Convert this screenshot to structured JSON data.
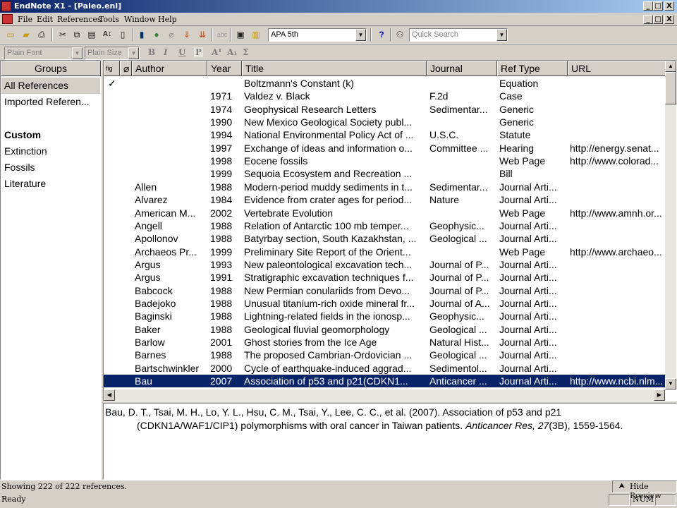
{
  "window": {
    "title": "EndNote X1 - [Paleo.enl]",
    "min": "_",
    "max": "□",
    "close": "X",
    "doc_min": "_",
    "doc_max": "□",
    "doc_close": "X"
  },
  "menu": [
    "File",
    "Edit",
    "References",
    "Tools",
    "Window",
    "Help"
  ],
  "toolbar": {
    "style": "APA 5th",
    "quick_search_placeholder": "Quick Search",
    "help_label": "?",
    "font": "Plain Font",
    "size": "Plain Size",
    "format_buttons": [
      "B",
      "I",
      "U",
      "P",
      "A¹",
      "A₁",
      "Σ"
    ]
  },
  "groups": {
    "header": "Groups",
    "items": [
      {
        "label": "All References"
      },
      {
        "label": "Imported Referen..."
      },
      {
        "label": "Custom"
      },
      {
        "label": "Extinction"
      },
      {
        "label": "Fossils"
      },
      {
        "label": "Literature"
      }
    ]
  },
  "columns": [
    "Author",
    "Year",
    "Title",
    "Journal",
    "Ref Type",
    "URL"
  ],
  "references": [
    {
      "mark": "✓",
      "author": "",
      "year": "",
      "title": "Boltzmann's Constant (k)",
      "journal": "",
      "type": "Equation",
      "url": ""
    },
    {
      "mark": "",
      "author": "",
      "year": "1971",
      "title": "Valdez v. Black",
      "journal": "F.2d",
      "type": "Case",
      "url": ""
    },
    {
      "mark": "",
      "author": "",
      "year": "1974",
      "title": "Geophysical Research Letters",
      "journal": "Sedimentar...",
      "type": "Generic",
      "url": ""
    },
    {
      "mark": "",
      "author": "",
      "year": "1990",
      "title": "New Mexico Geological Society publ...",
      "journal": "",
      "type": "Generic",
      "url": ""
    },
    {
      "mark": "",
      "author": "",
      "year": "1994",
      "title": "National Environmental Policy Act of ...",
      "journal": "U.S.C.",
      "type": "Statute",
      "url": ""
    },
    {
      "mark": "",
      "author": "",
      "year": "1997",
      "title": "Exchange of ideas and information o...",
      "journal": "Committee ...",
      "type": "Hearing",
      "url": "http://energy.senat..."
    },
    {
      "mark": "",
      "author": "",
      "year": "1998",
      "title": "Eocene fossils",
      "journal": "",
      "type": "Web Page",
      "url": "http://www.colorad..."
    },
    {
      "mark": "",
      "author": "",
      "year": "1999",
      "title": "Sequoia Ecosystem and Recreation ...",
      "journal": "",
      "type": "Bill",
      "url": ""
    },
    {
      "mark": "",
      "author": "Allen",
      "year": "1988",
      "title": "Modern-period muddy sediments in t...",
      "journal": "Sedimentar...",
      "type": "Journal Arti...",
      "url": ""
    },
    {
      "mark": "",
      "author": "Alvarez",
      "year": "1984",
      "title": "Evidence from crater ages for period...",
      "journal": "Nature",
      "type": "Journal Arti...",
      "url": ""
    },
    {
      "mark": "",
      "author": "American M...",
      "year": "2002",
      "title": "Vertebrate Evolution",
      "journal": "",
      "type": "Web Page",
      "url": "http://www.amnh.or..."
    },
    {
      "mark": "",
      "author": "Angell",
      "year": "1988",
      "title": "Relation of Antarctic 100 mb temper...",
      "journal": "Geophysic...",
      "type": "Journal Arti...",
      "url": ""
    },
    {
      "mark": "",
      "author": "Apollonov",
      "year": "1988",
      "title": "Batyrbay section, South Kazakhstan, ...",
      "journal": "Geological ...",
      "type": "Journal Arti...",
      "url": ""
    },
    {
      "mark": "",
      "author": "Archaeos Pr...",
      "year": "1999",
      "title": "Preliminary Site Report of the Orient...",
      "journal": "",
      "type": "Web Page",
      "url": "http://www.archaeo..."
    },
    {
      "mark": "",
      "author": "Argus",
      "year": "1993",
      "title": "New paleontological excavation tech...",
      "journal": "Journal of P...",
      "type": "Journal Arti...",
      "url": ""
    },
    {
      "mark": "",
      "author": "Argus",
      "year": "1991",
      "title": "Stratigraphic excavation techniques f...",
      "journal": "Journal of P...",
      "type": "Journal Arti...",
      "url": ""
    },
    {
      "mark": "",
      "author": "Babcock",
      "year": "1988",
      "title": "New Permian conulariids from Devo...",
      "journal": "Journal of P...",
      "type": "Journal Arti...",
      "url": ""
    },
    {
      "mark": "",
      "author": "Badejoko",
      "year": "1988",
      "title": "Unusual titanium-rich oxide mineral fr...",
      "journal": "Journal of A...",
      "type": "Journal Arti...",
      "url": ""
    },
    {
      "mark": "",
      "author": "Baginski",
      "year": "1988",
      "title": "Lightning-related fields in the ionosp...",
      "journal": "Geophysic...",
      "type": "Journal Arti...",
      "url": ""
    },
    {
      "mark": "",
      "author": "Baker",
      "year": "1988",
      "title": "Geological fluvial geomorphology",
      "journal": "Geological ...",
      "type": "Journal Arti...",
      "url": ""
    },
    {
      "mark": "",
      "author": "Barlow",
      "year": "2001",
      "title": "Ghost stories from the Ice Age",
      "journal": "Natural Hist...",
      "type": "Journal Arti...",
      "url": ""
    },
    {
      "mark": "",
      "author": "Barnes",
      "year": "1988",
      "title": "The proposed Cambrian-Ordovician ...",
      "journal": "Geological ...",
      "type": "Journal Arti...",
      "url": ""
    },
    {
      "mark": "",
      "author": "Bartschwinkler",
      "year": "2000",
      "title": "Cycle of earthquake-induced aggrad...",
      "journal": "Sedimentol...",
      "type": "Journal Arti...",
      "url": ""
    },
    {
      "mark": "",
      "author": "Bau",
      "year": "2007",
      "title": "Association of p53 and p21(CDKN1...",
      "journal": "Anticancer ...",
      "type": "Journal Arti...",
      "url": "http://www.ncbi.nlm..."
    }
  ],
  "preview": {
    "line1": "Bau, D. T., Tsai, M. H., Lo, Y. L., Hsu, C. M., Tsai, Y., Lee, C. C., et al. (2007). Association of p53 and p21",
    "line2_pre": "(CDKN1A/WAF1/CIP1) polymorphisms with oral cancer in Taiwan patients. ",
    "line2_journal": "Anticancer Res, 27",
    "line2_post": "(3B), 1559-1564."
  },
  "status": {
    "showing": "Showing 222 of 222 references.",
    "hide_preview": "Hide Preview",
    "ready": "Ready",
    "num": "NUM"
  }
}
